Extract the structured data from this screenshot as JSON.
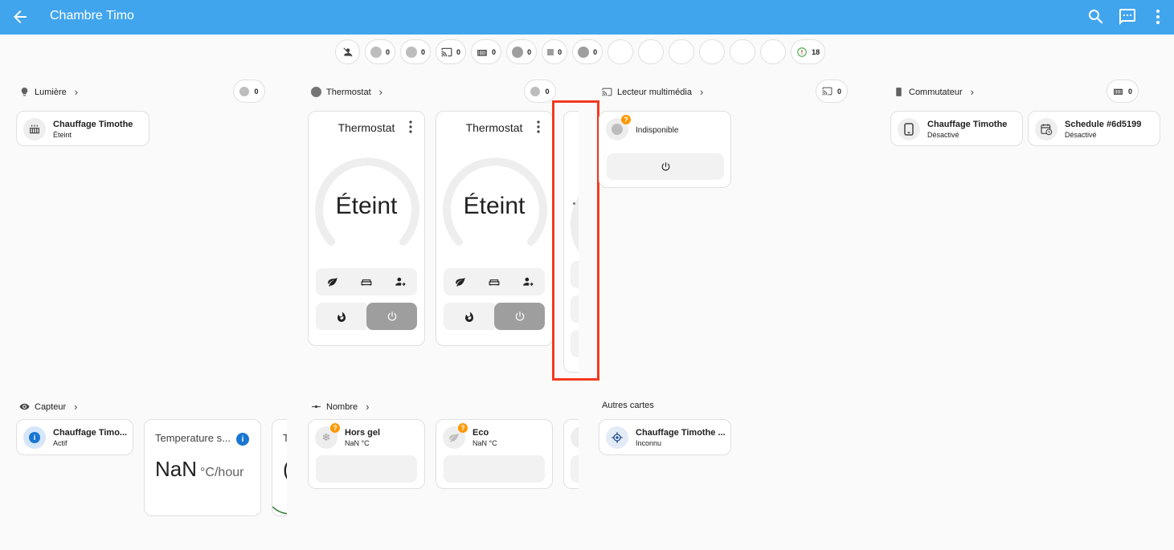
{
  "header": {
    "title": "Chambre Timo"
  },
  "badges": [
    {
      "icon": "person-off-icon",
      "count": ""
    },
    {
      "icon": "lightbulb-group-icon",
      "count": "0"
    },
    {
      "icon": "thermostat-icon",
      "count": "0"
    },
    {
      "icon": "cast-icon",
      "count": "0"
    },
    {
      "icon": "radiator-icon",
      "count": "0"
    },
    {
      "icon": "check-circle-icon",
      "count": "0"
    },
    {
      "icon": "stop-icon",
      "count": "0"
    },
    {
      "icon": "check-circle-icon",
      "count": "0"
    },
    {
      "icon": "",
      "count": ""
    },
    {
      "icon": "",
      "count": ""
    },
    {
      "icon": "",
      "count": ""
    },
    {
      "icon": "",
      "count": ""
    },
    {
      "icon": "",
      "count": ""
    },
    {
      "icon": "",
      "count": ""
    },
    {
      "icon": "alert-circle-icon",
      "count": "18"
    }
  ],
  "sections": {
    "lumiere": {
      "title": "Lumière",
      "badge": "0",
      "tile": {
        "name": "Chauffage Timothe",
        "state": "Éteint"
      }
    },
    "thermostat": {
      "title": "Thermostat",
      "badge": "0",
      "cards": [
        {
          "name": "Thermostat",
          "state": "Éteint"
        },
        {
          "name": "Thermostat",
          "state": "Éteint"
        }
      ]
    },
    "lecteur": {
      "title": "Lecteur multimédia",
      "badge": "0",
      "tile": {
        "state": "Indisponible"
      }
    },
    "commutateur": {
      "title": "Commutateur",
      "badge": "0",
      "tiles": [
        {
          "name": "Chauffage Timothe",
          "state": "Désactivé"
        },
        {
          "name": "Schedule #6d5199",
          "state": "Désactivé"
        }
      ]
    },
    "capteur": {
      "title": "Capteur",
      "tile": {
        "name": "Chauffage Timo...",
        "state": "Actif"
      },
      "sensor": {
        "name": "Temperature s...",
        "value": "NaN",
        "unit": "°C/hour"
      },
      "partial_letter": "T",
      "partial_value": "("
    },
    "nombre": {
      "title": "Nombre",
      "tiles": [
        {
          "name": "Hors gel",
          "state": "NaN °C"
        },
        {
          "name": "Eco",
          "state": "NaN °C"
        }
      ]
    },
    "autres": {
      "title": "Autres cartes",
      "tile": {
        "name": "Chauffage Timothe ...",
        "state": "Inconnu"
      }
    }
  },
  "colors": {
    "header": "#41a5ee",
    "highlight": "#f23a20",
    "badge_warning": "#ff9800",
    "info_blue": "#1976d2"
  }
}
